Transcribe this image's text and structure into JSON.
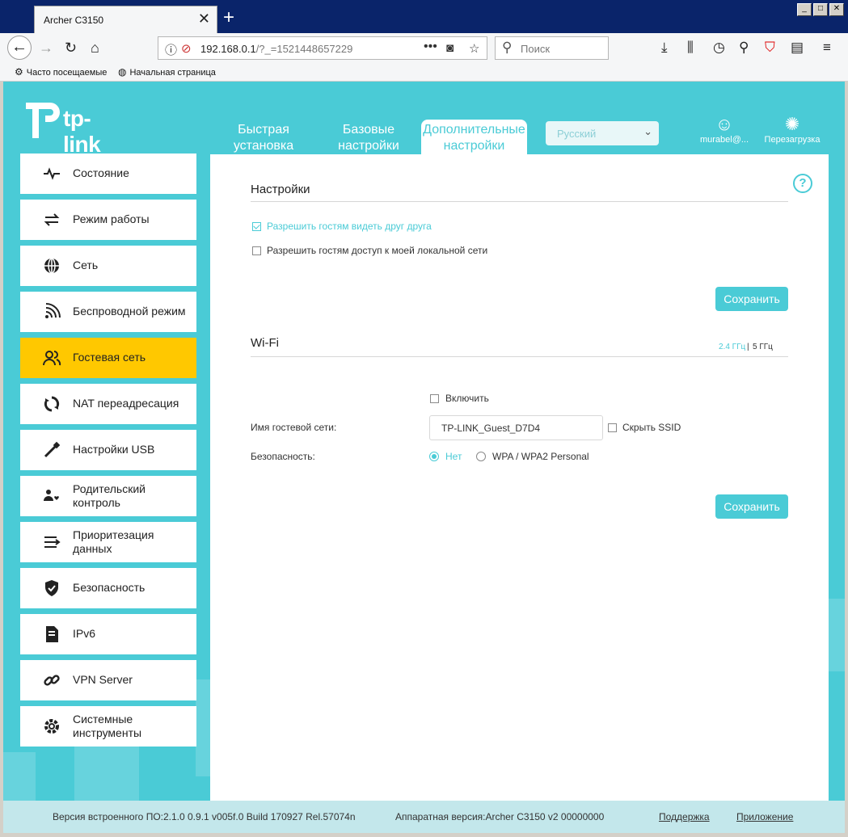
{
  "browser": {
    "tab_title": "Archer C3150",
    "url_main": "192.168.0.1",
    "url_rest": "/?_=1521448657229",
    "search_placeholder": "Поиск",
    "bookmarks": [
      "Часто посещаемые",
      "Начальная страница"
    ]
  },
  "router": {
    "logo": "tp-link",
    "main_tabs": [
      {
        "label": "Быстрая установка",
        "line1": "Быстрая",
        "line2": "установка"
      },
      {
        "label": "Базовые настройки",
        "line1": "Базовые",
        "line2": "настройки"
      },
      {
        "label": "Дополнительные настройки",
        "line1": "Дополнительные",
        "line2": "настройки"
      }
    ],
    "language": "Русский",
    "user": "murabel@...",
    "reboot": "Перезагрузка"
  },
  "sidebar": {
    "items": [
      {
        "label": "Состояние",
        "icon": "status-icon"
      },
      {
        "label": "Режим работы",
        "icon": "mode-icon"
      },
      {
        "label": "Сеть",
        "icon": "globe-icon"
      },
      {
        "label": "Беспроводной режим",
        "icon": "wifi-icon"
      },
      {
        "label": "Гостевая сеть",
        "icon": "guests-icon",
        "active": true
      },
      {
        "label": "NAT переадресация",
        "icon": "nat-icon"
      },
      {
        "label": "Настройки USB",
        "icon": "usb-icon"
      },
      {
        "label": "Родительский контроль",
        "line1": "Родительский",
        "line2": "контроль",
        "icon": "parental-icon"
      },
      {
        "label": "Приоритезация данных",
        "line1": "Приоритезация",
        "line2": "данных",
        "icon": "qos-icon"
      },
      {
        "label": "Безопасность",
        "icon": "shield-icon"
      },
      {
        "label": "IPv6",
        "icon": "ipv6-icon"
      },
      {
        "label": "VPN Server",
        "icon": "link-icon"
      },
      {
        "label": "Системные инструменты",
        "line1": "Системные",
        "line2": "инструменты",
        "icon": "gear-icon"
      }
    ]
  },
  "settings": {
    "title": "Настройки",
    "allow_see_each_other": "Разрешить гостям видеть друг друга",
    "allow_see_each_other_checked": true,
    "allow_local_access": "Разрешить гостям доступ к моей локальной сети",
    "allow_local_access_checked": false,
    "save_label": "Сохранить"
  },
  "wifi": {
    "title": "Wi-Fi",
    "band_24": "2.4 ГГц",
    "band_sep": "|",
    "band_5": "5 ГГц",
    "enable_label": "Включить",
    "enable_checked": false,
    "ssid_label": "Имя гостевой сети:",
    "ssid_value": "TP-LINK_Guest_D7D4",
    "hide_ssid_label": "Скрыть SSID",
    "security_label": "Безопасность:",
    "security_none": "Нет",
    "security_wpa": "WPA / WPA2 Personal",
    "security_selected": "Нет",
    "save_label": "Сохранить"
  },
  "footer": {
    "firmware": "Версия встроенного ПО:2.1.0 0.9.1 v005f.0 Build 170927 Rel.57074n",
    "hardware": "Аппаратная версия:Archer C3150 v2 00000000",
    "support": "Поддержка",
    "app": "Приложение"
  },
  "colors": {
    "accent": "#4acbd6",
    "active_item": "#ffc800"
  }
}
